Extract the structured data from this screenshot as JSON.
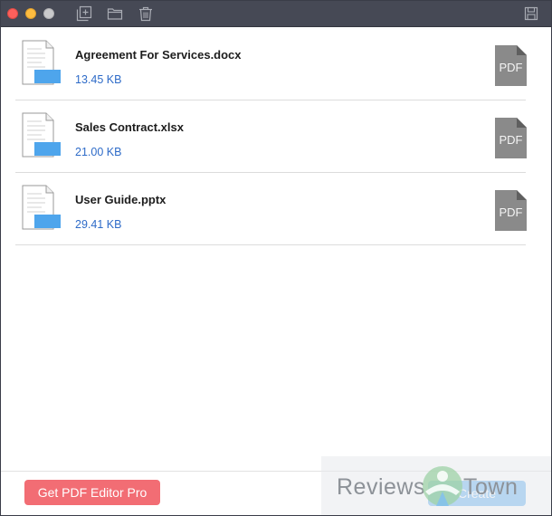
{
  "window": {
    "toolbar_icons": [
      "add-file-icon",
      "folder-icon",
      "trash-icon",
      "save-icon"
    ]
  },
  "files": [
    {
      "name": "Agreement For Services.docx",
      "size": "13.45 KB",
      "output_format": "PDF"
    },
    {
      "name": "Sales Contract.xlsx",
      "size": "21.00 KB",
      "output_format": "PDF"
    },
    {
      "name": "User Guide.pptx",
      "size": "29.41 KB",
      "output_format": "PDF"
    }
  ],
  "footer": {
    "promo_label": "Get PDF Editor Pro",
    "create_label": "Create"
  },
  "watermark": {
    "text_left": "Reviews",
    "text_right": "Town"
  },
  "colors": {
    "titlebar": "#464955",
    "file_size": "#2e6bc8",
    "promo_button": "#f26d74",
    "create_button": "#7fbff3",
    "doc_accent": "#4ea5ec",
    "pdf_icon": "#8a8a8a"
  }
}
